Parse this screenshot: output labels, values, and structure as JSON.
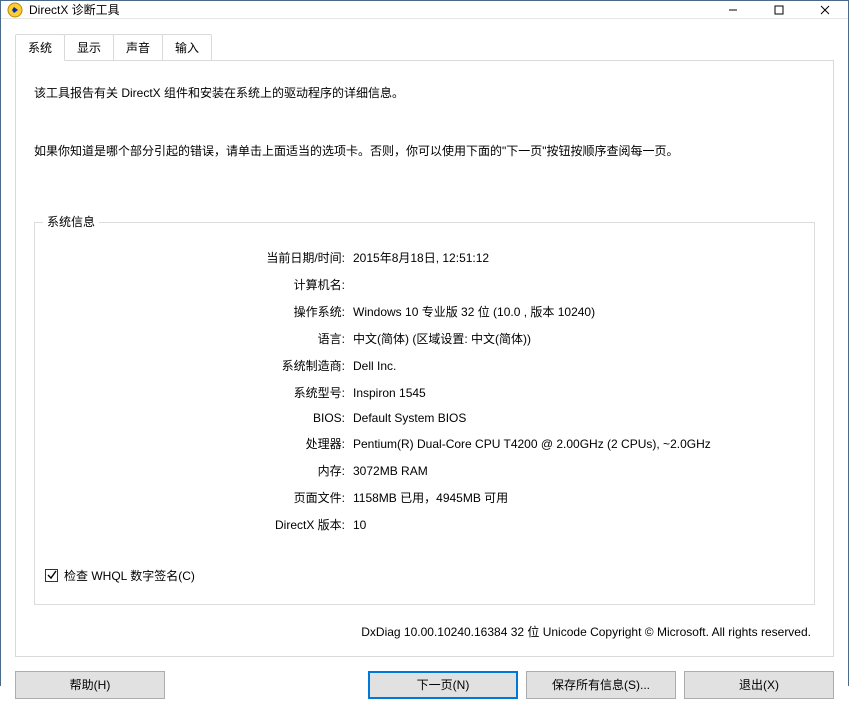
{
  "titlebar": {
    "title": "DirectX 诊断工具"
  },
  "tabs": [
    {
      "label": "系统"
    },
    {
      "label": "显示"
    },
    {
      "label": "声音"
    },
    {
      "label": "输入"
    }
  ],
  "intro": {
    "p1": "该工具报告有关 DirectX 组件和安装在系统上的驱动程序的详细信息。",
    "p2": "如果你知道是哪个部分引起的错误，请单击上面适当的选项卡。否则，你可以使用下面的\"下一页\"按钮按顺序查阅每一页。"
  },
  "group_title": "系统信息",
  "info": {
    "datetime_label": "当前日期/时间:",
    "datetime_value": "2015年8月18日, 12:51:12",
    "computer_name_label": "计算机名:",
    "computer_name_value": "",
    "os_label": "操作系统:",
    "os_value": "Windows 10 专业版 32 位 (10.0 , 版本 10240)",
    "lang_label": "语言:",
    "lang_value": "中文(简体) (区域设置: 中文(简体))",
    "manufacturer_label": "系统制造商:",
    "manufacturer_value": "Dell Inc.",
    "model_label": "系统型号:",
    "model_value": "Inspiron 1545",
    "bios_label": "BIOS:",
    "bios_value": "Default System BIOS",
    "cpu_label": "处理器:",
    "cpu_value": "Pentium(R) Dual-Core CPU       T4200  @ 2.00GHz (2 CPUs), ~2.0GHz",
    "ram_label": "内存:",
    "ram_value": "3072MB RAM",
    "pagefile_label": "页面文件:",
    "pagefile_value": "1158MB 已用，4945MB 可用",
    "dx_label": "DirectX 版本:",
    "dx_value": "10"
  },
  "whql_checkbox_label": "检查 WHQL 数字签名(C)",
  "whql_checked": true,
  "footer": "DxDiag 10.00.10240.16384 32 位 Unicode  Copyright © Microsoft. All rights reserved.",
  "buttons": {
    "help": "帮助(H)",
    "next": "下一页(N)",
    "save_all": "保存所有信息(S)...",
    "exit": "退出(X)"
  }
}
